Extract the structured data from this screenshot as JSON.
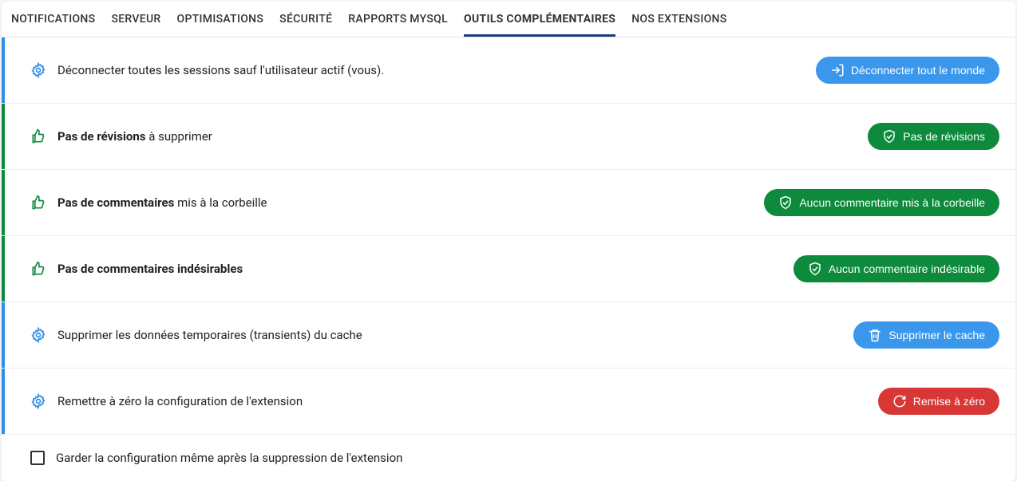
{
  "tabs": [
    {
      "label": "NOTIFICATIONS",
      "active": false
    },
    {
      "label": "SERVEUR",
      "active": false
    },
    {
      "label": "OPTIMISATIONS",
      "active": false
    },
    {
      "label": "SÉCURITÉ",
      "active": false
    },
    {
      "label": "RAPPORTS MYSQL",
      "active": false
    },
    {
      "label": "OUTILS COMPLÉMENTAIRES",
      "active": true
    },
    {
      "label": "NOS EXTENSIONS",
      "active": false
    }
  ],
  "rows": [
    {
      "accent": "blue",
      "icon": "gear",
      "text_bold": "",
      "text_rest": "Déconnecter toutes les sessions sauf l'utilisateur actif (vous).",
      "button": {
        "label": "Déconnecter tout le monde",
        "color": "blue",
        "icon": "logout"
      }
    },
    {
      "accent": "green",
      "icon": "thumbs-up",
      "text_bold": "Pas de révisions",
      "text_rest": " à supprimer",
      "button": {
        "label": "Pas de révisions",
        "color": "green",
        "icon": "shield"
      }
    },
    {
      "accent": "green",
      "icon": "thumbs-up",
      "text_bold": "Pas de commentaires",
      "text_rest": " mis à la corbeille",
      "button": {
        "label": "Aucun commentaire mis à la corbeille",
        "color": "green",
        "icon": "shield"
      }
    },
    {
      "accent": "green",
      "icon": "thumbs-up",
      "text_bold": "Pas de commentaires indésirables",
      "text_rest": "",
      "button": {
        "label": "Aucun commentaire indésirable",
        "color": "green",
        "icon": "shield"
      }
    },
    {
      "accent": "blue",
      "icon": "gear",
      "text_bold": "",
      "text_rest": "Supprimer les données temporaires (transients) du cache",
      "button": {
        "label": "Supprimer le cache",
        "color": "blue",
        "icon": "trash"
      }
    },
    {
      "accent": "blue",
      "icon": "gear",
      "text_bold": "",
      "text_rest": "Remettre à zéro la configuration de l'extension",
      "button": {
        "label": "Remise à zéro",
        "color": "red",
        "icon": "refresh"
      }
    }
  ],
  "footer": {
    "label": "Garder la configuration même après la suppression de l'extension"
  }
}
